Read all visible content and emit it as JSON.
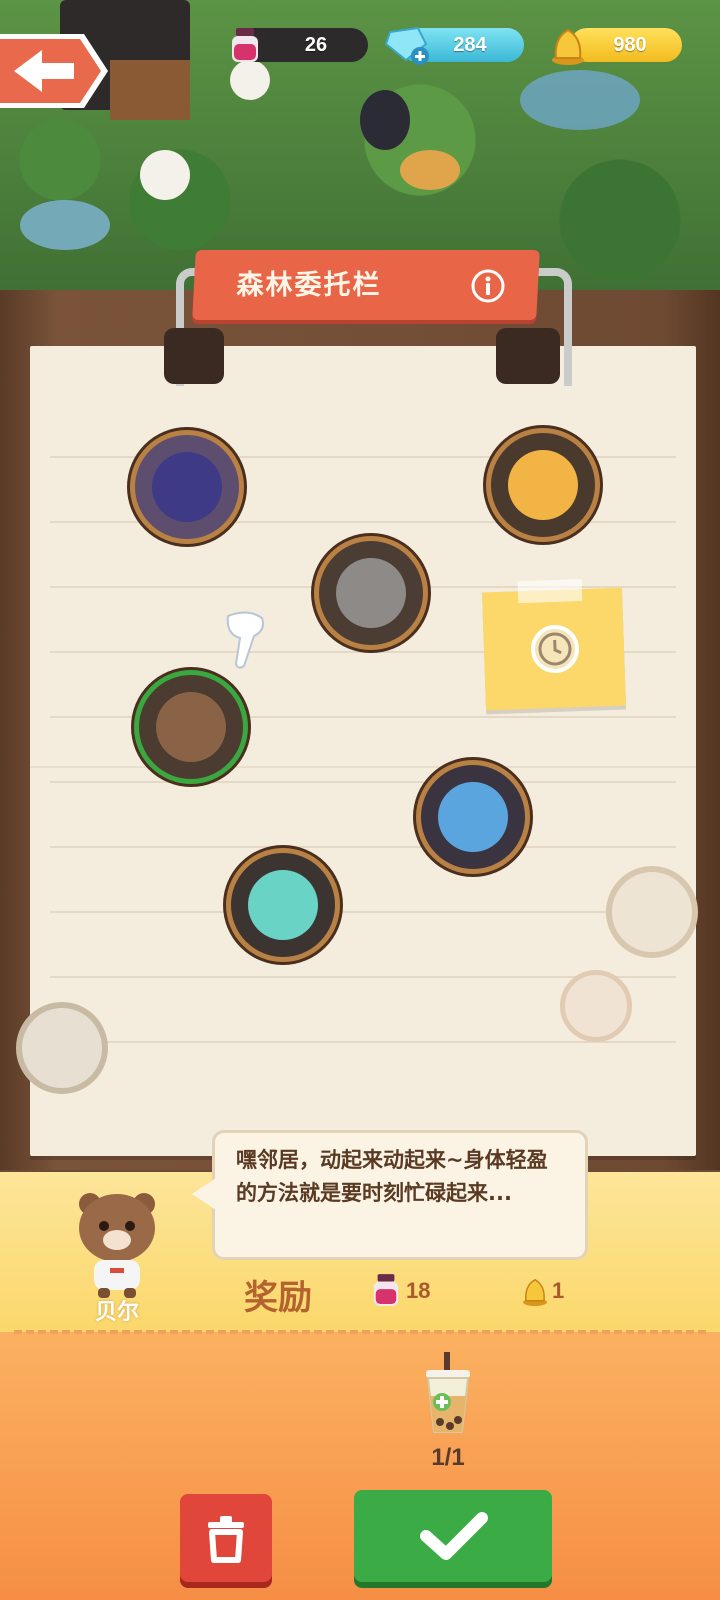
{
  "hud": {
    "ink_count": "26",
    "gem_count": "284",
    "coin_count": "980"
  },
  "board": {
    "title": "森林委托栏"
  },
  "dialog": {
    "speaker_name": "贝尔",
    "message": "嘿邻居，动起来动起来~身体轻盈的方法就是要时刻忙碌起来..."
  },
  "reward": {
    "label": "奖励",
    "ink_amount": "18",
    "coin_amount": "1"
  },
  "requirement": {
    "progress": "1/1"
  },
  "colors": {
    "accent_red": "#e86548",
    "confirm_green": "#3bab46",
    "selected_ring": "#3aa83f"
  }
}
